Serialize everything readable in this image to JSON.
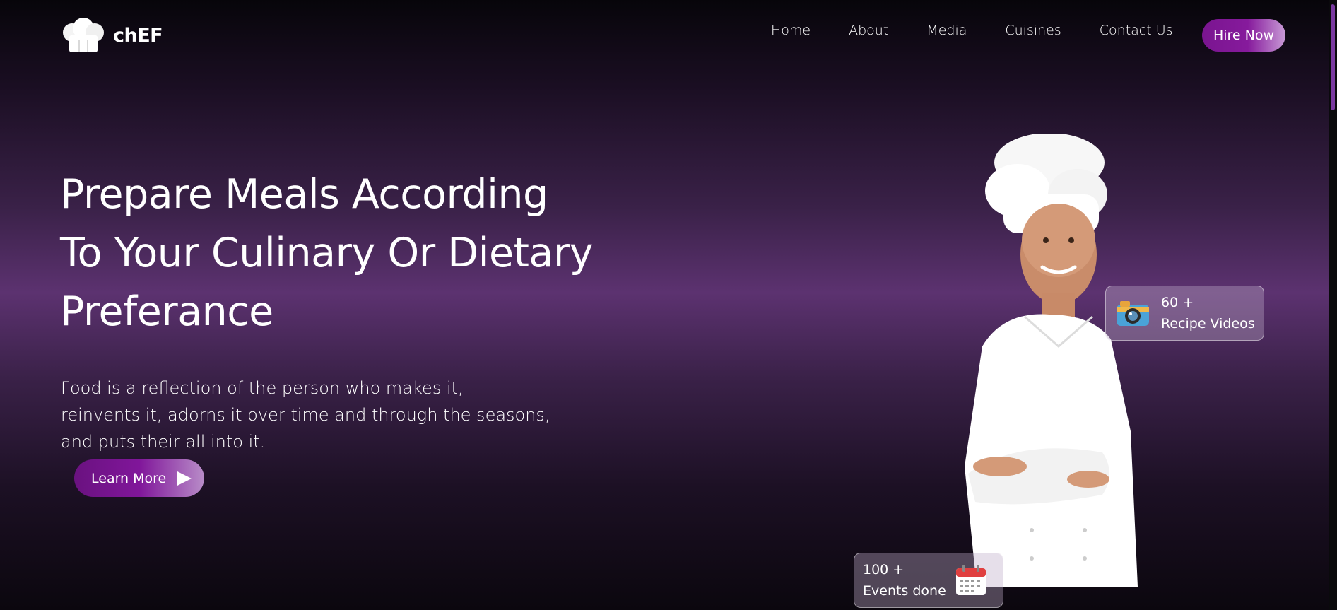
{
  "header": {
    "logo_text": "chEF",
    "logo_icon": "chef-hat-icon",
    "nav": [
      "Home",
      "About",
      "Media",
      "Cuisines",
      "Contact Us"
    ],
    "hire_label": "Hire Now"
  },
  "hero": {
    "title_lines": [
      "Prepare Meals According",
      "To Your Culinary Or Dietary",
      "Preferance"
    ],
    "description_lines": [
      "Food is a reflection of the person who makes it,",
      "reinvents it, adorns it over time and through the seasons,",
      "and puts their all into it."
    ],
    "learn_more_label": "Learn More"
  },
  "stats": {
    "videos": {
      "count": "60 +",
      "label": "Recipe Videos",
      "icon": "camera-icon"
    },
    "events": {
      "count": "100 +",
      "label": "Events done",
      "icon": "calendar-icon"
    }
  },
  "colors": {
    "accent": "#7a1590",
    "background_mid": "#5c3270"
  }
}
